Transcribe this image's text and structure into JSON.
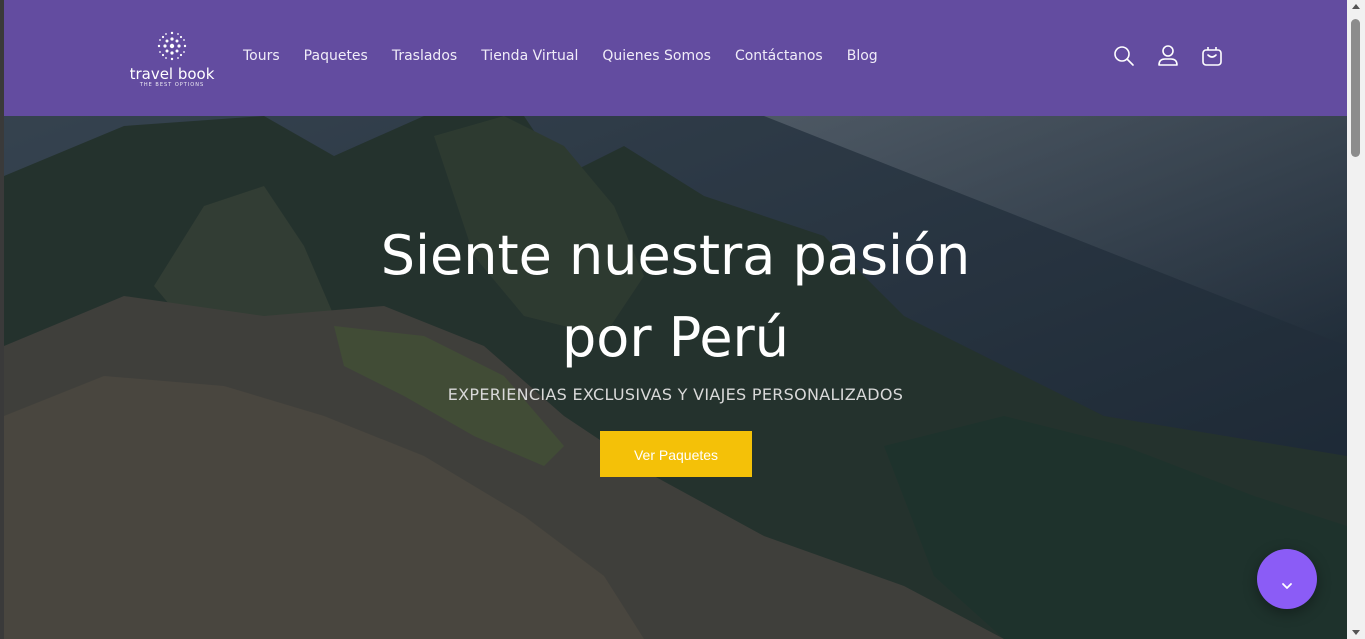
{
  "brand": {
    "name": "travel book",
    "tagline": "THE BEST OPTIONS"
  },
  "nav": {
    "items": [
      {
        "label": "Tours"
      },
      {
        "label": "Paquetes"
      },
      {
        "label": "Traslados"
      },
      {
        "label": "Tienda Virtual"
      },
      {
        "label": "Quienes Somos"
      },
      {
        "label": "Contáctanos"
      },
      {
        "label": "Blog"
      }
    ]
  },
  "header_icons": [
    "search-icon",
    "account-icon",
    "cart-icon"
  ],
  "hero": {
    "title_line1": "Siente nuestra pasión",
    "title_line2": "por Perú",
    "subtitle": "EXPERIENCIAS EXCLUSIVAS Y VIAJES PERSONALIZADOS",
    "cta_label": "Ver Paquetes"
  },
  "fab": {
    "icon": "chevron-down-icon"
  },
  "colors": {
    "header_bg": "#634ca0",
    "cta_bg": "#f4c108",
    "fab_bg": "#8b5cf6"
  }
}
